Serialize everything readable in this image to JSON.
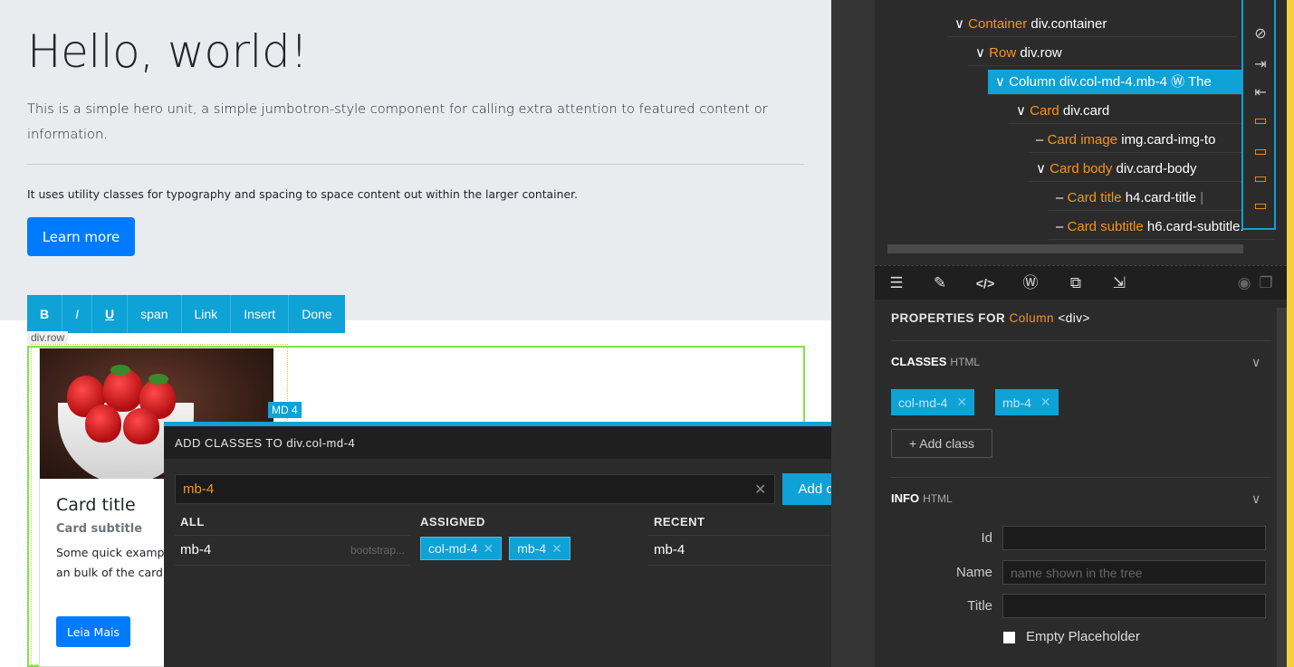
{
  "page": {
    "hero_title": "Hello, world!",
    "lead": "This is a simple hero unit, a simple jumbotron-style component for calling extra attention to featured content or information.",
    "small": "It uses utility classes for typography and spacing to space content out within the larger container.",
    "learn_more": "Learn more",
    "row_label": "div.row",
    "md_label": "MD 4",
    "card": {
      "title": "Card title",
      "subtitle": "Card subtitle",
      "text": "Some quick examp on the card title an bulk of the card's c",
      "button": "Leia Mais"
    }
  },
  "rte_toolbar": [
    "B",
    "I",
    "U",
    "span",
    "Link",
    "Insert",
    "Done"
  ],
  "dialog": {
    "title": "ADD CLASSES TO div.col-md-4",
    "input_value": "mb-4",
    "add_button": "Add class",
    "close": "✕",
    "clear": "✕",
    "all_header": "ALL",
    "assigned_header": "ASSIGNED",
    "recent_header": "RECENT",
    "all_item_name": "mb-4",
    "all_item_source": "bootstrap...",
    "assigned": [
      "col-md-4",
      "mb-4"
    ],
    "recent_item": "mb-4"
  },
  "tree": {
    "items": [
      {
        "type": "Container",
        "tag": "div.container",
        "prefix": "∨"
      },
      {
        "type": "Row",
        "tag": "div.row",
        "prefix": "∨"
      },
      {
        "type": "Column",
        "tag": "div.col-md-4.mb-4",
        "extra": "Ⓦ The",
        "prefix": "∨"
      },
      {
        "type": "Card",
        "tag": "div.card",
        "prefix": "∨"
      },
      {
        "type": "Card image",
        "tag": "img.card-img-to",
        "prefix": "–"
      },
      {
        "type": "Card body",
        "tag": "div.card-body",
        "prefix": "∨"
      },
      {
        "type": "Card title",
        "tag": "h4.card-title",
        "extra": "|",
        "prefix": "–"
      },
      {
        "type": "Card subtitle",
        "tag": "h6.card-subtitle.",
        "prefix": "–"
      }
    ]
  },
  "side_icons": [
    "eye-slash-icon",
    "indent-icon",
    "outdent-icon",
    "wrap-top-icon",
    "wrap-bottom-icon",
    "wrap-before-icon",
    "wrap-after-icon"
  ],
  "tabs": [
    "sliders-icon",
    "brush-icon",
    "code-icon",
    "wordpress-icon",
    "component-icon",
    "export-icon"
  ],
  "props": {
    "prefix": "PROPERTIES FOR",
    "type": "Column",
    "tag": "<div>",
    "classes_title": "CLASSES",
    "classes_sub": "HTML",
    "classes": [
      "col-md-4",
      "mb-4"
    ],
    "add_class": "+ Add class",
    "info_title": "INFO",
    "info_sub": "HTML",
    "id_label": "Id",
    "name_label": "Name",
    "name_placeholder": "name shown in the tree",
    "title_label": "Title",
    "empty_placeholder": "Empty Placeholder"
  },
  "colors": {
    "accent": "#0ea2d6",
    "primary_button": "#007bff",
    "element_type": "#f7941d",
    "panel_bg": "#2b2b2b"
  }
}
